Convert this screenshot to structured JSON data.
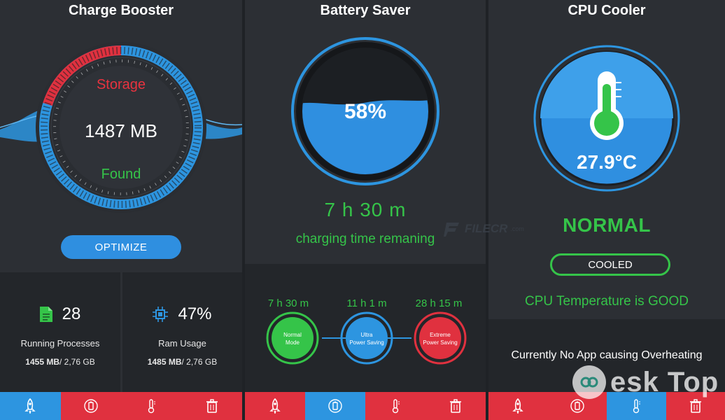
{
  "colors": {
    "accent_blue": "#2d95e0",
    "accent_red": "#e0313f",
    "accent_green": "#35c449",
    "panel_bg": "#2c2f34"
  },
  "charge_booster": {
    "title": "Charge Booster",
    "storage_label": "Storage",
    "amount": "1487 MB",
    "found_label": "Found",
    "optimize_label": "OPTIMIZE",
    "used_fraction": 0.25,
    "stats": [
      {
        "icon": "file-icon",
        "value": "28",
        "label": "Running Processes",
        "size_bold": "1455 MB",
        "size_rest": "/ 2,76 GB"
      },
      {
        "icon": "chip-icon",
        "value": "47%",
        "label": "Ram Usage",
        "size_bold": "1485 MB",
        "size_rest": "/ 2,76 GB"
      }
    ],
    "nav_active": 0
  },
  "battery_saver": {
    "title": "Battery Saver",
    "percent": "58%",
    "level": 0.58,
    "time": "7 h  30 m",
    "time_label": "charging time remaning",
    "modes": [
      {
        "time": "7 h 30 m",
        "name_line1": "Normal",
        "name_line2": "Mode",
        "color": "#35c449"
      },
      {
        "time": "11 h 1 m",
        "name_line1": "Ultra",
        "name_line2": "Power Saving",
        "color": "#2d95e0"
      },
      {
        "time": "28 h 15 m",
        "name_line1": "Extreme",
        "name_line2": "Power Saving",
        "color": "#e0313f"
      }
    ],
    "nav_active": 1
  },
  "cpu_cooler": {
    "title": "CPU Cooler",
    "temperature": "27.9°C",
    "status": "NORMAL",
    "cooled_label": "COOLED",
    "good_text": "CPU Temperature is GOOD",
    "no_app_text": "Currently No App causing Overheating",
    "nav_active": 2
  },
  "nav_icons": [
    "rocket-icon",
    "battery-icon",
    "thermometer-icon",
    "trash-icon"
  ],
  "watermarks": {
    "filecr": "FILECR",
    "filecr_sub": ".com",
    "desktop": "esk Top"
  }
}
